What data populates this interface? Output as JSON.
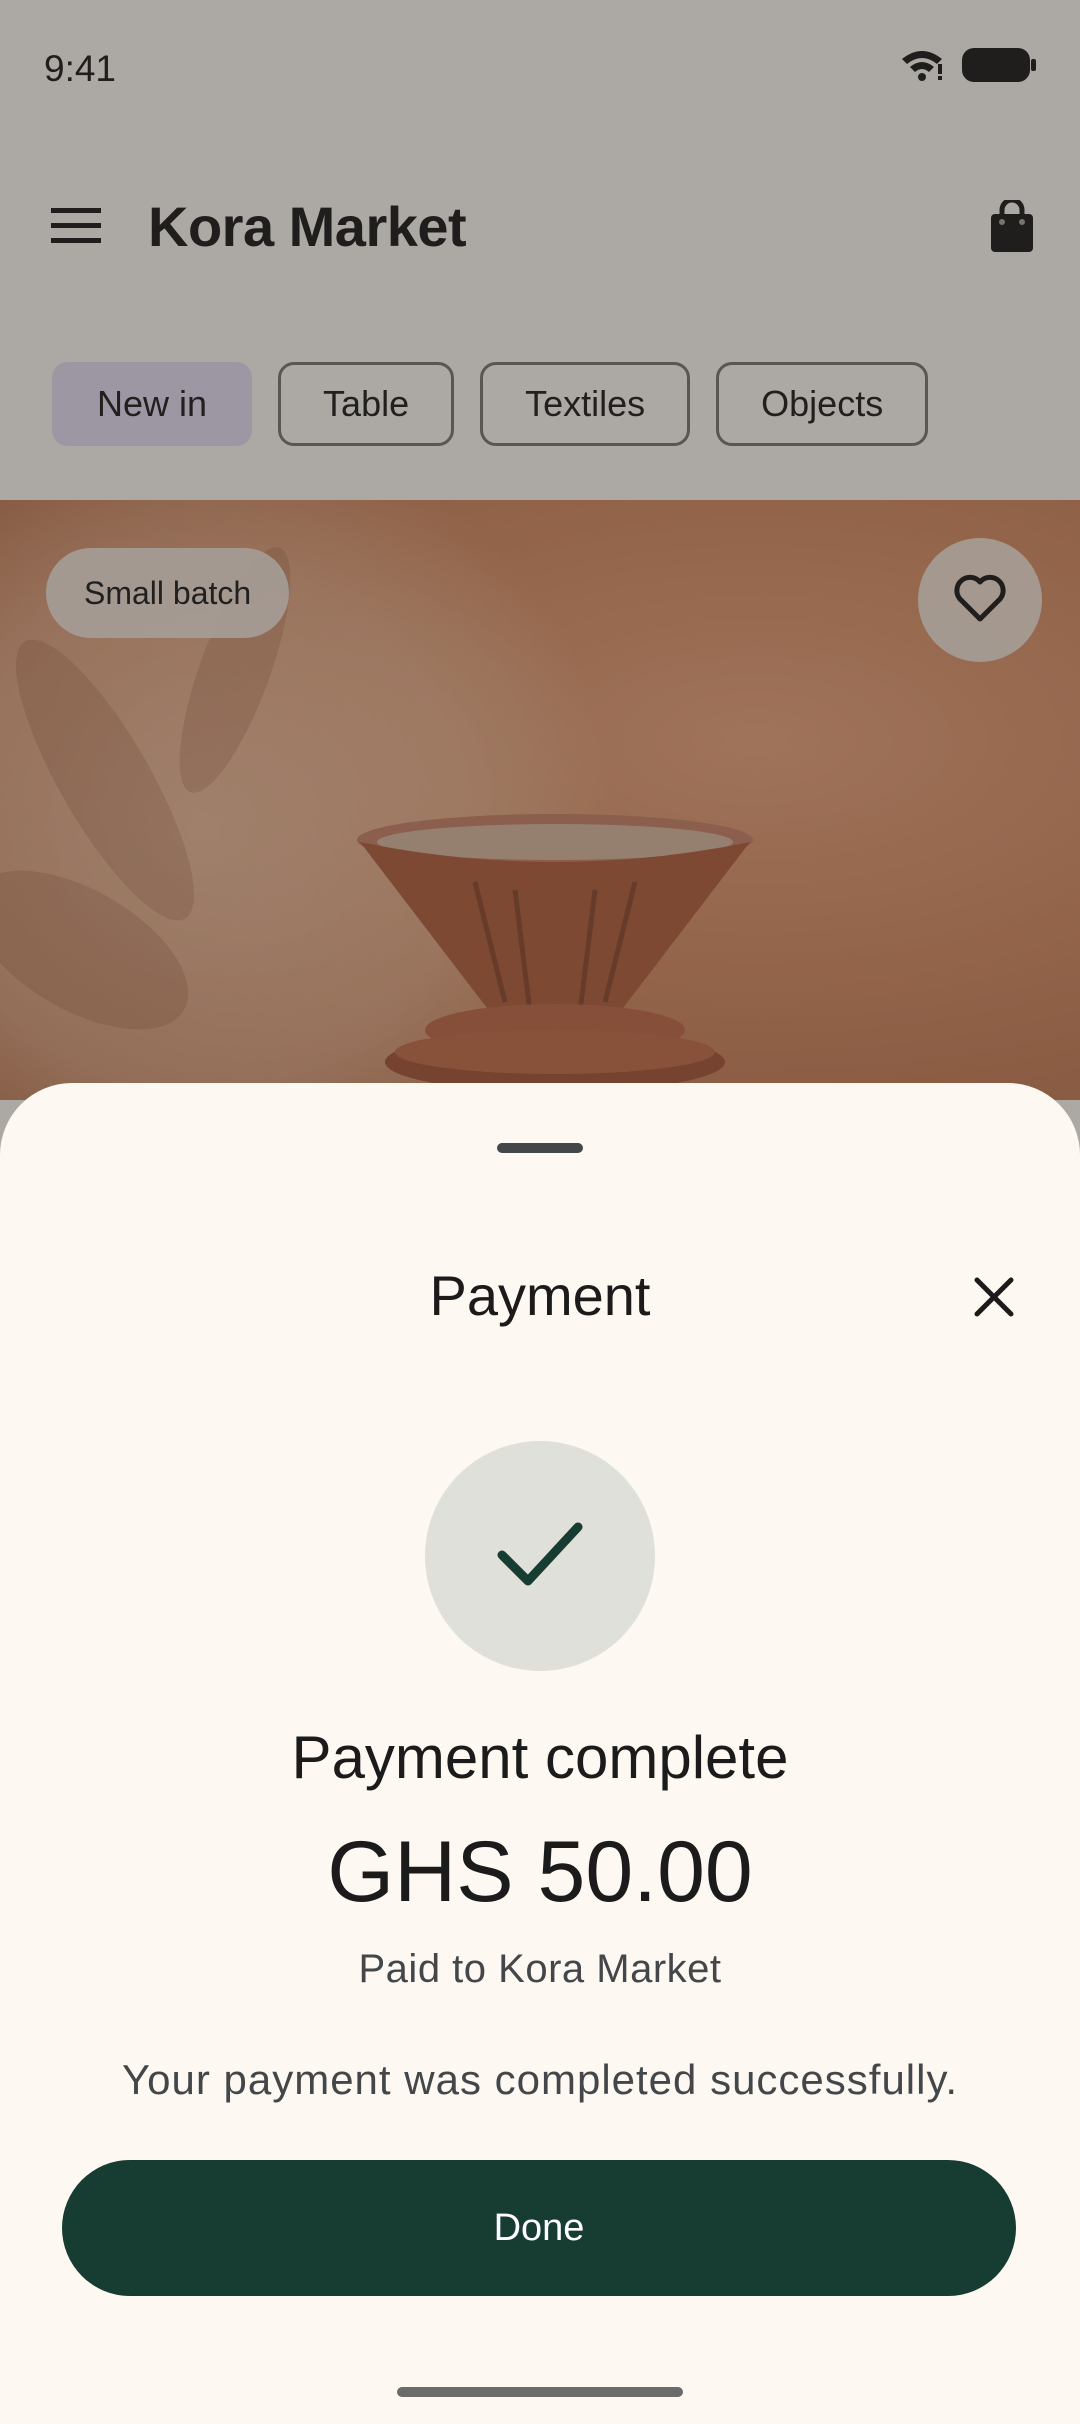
{
  "status_bar": {
    "time": "9:41"
  },
  "app_bar": {
    "title": "Kora Market"
  },
  "chips": [
    {
      "label": "New in",
      "selected": true
    },
    {
      "label": "Table",
      "selected": false
    },
    {
      "label": "Textiles",
      "selected": false
    },
    {
      "label": "Objects",
      "selected": false
    }
  ],
  "product": {
    "badge": "Small batch"
  },
  "sheet": {
    "title": "Payment",
    "status_heading": "Payment complete",
    "amount": "GHS 50.00",
    "payee": "Paid to Kora Market",
    "message": "Your payment was completed successfully.",
    "done_label": "Done"
  },
  "colors": {
    "primary": "#173c31",
    "selected_chip": "#e6dcf2",
    "sheet_background": "#fdf9f2",
    "success_circle": "#dfe0d9"
  },
  "icons": [
    "menu-icon",
    "shopping-bag-icon",
    "heart-icon",
    "close-icon",
    "checkmark-icon",
    "wifi-icon",
    "battery-icon"
  ]
}
